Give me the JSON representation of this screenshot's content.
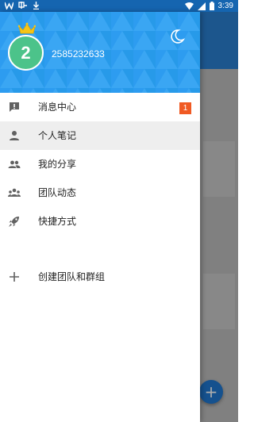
{
  "status_bar": {
    "time": "3:39"
  },
  "drawer": {
    "header": {
      "avatar_initial": "2",
      "user_id": "2585232633",
      "icons": [
        "crown-icon",
        "moon-icon"
      ]
    },
    "menu": {
      "items": [
        {
          "label": "消息中心",
          "icon": "message-icon",
          "badge": "1",
          "active": false
        },
        {
          "label": "个人笔记",
          "icon": "person-icon",
          "active": true
        },
        {
          "label": "我的分享",
          "icon": "share-people-icon",
          "active": false
        },
        {
          "label": "团队动态",
          "icon": "team-icon",
          "active": false
        },
        {
          "label": "快捷方式",
          "icon": "rocket-icon",
          "active": false
        }
      ],
      "create_item": {
        "label": "创建团队和群组",
        "icon": "plus-icon"
      }
    }
  },
  "colors": {
    "header_blue": "#2d9cf0",
    "avatar_green": "#4cc38a",
    "badge_orange": "#f05a23",
    "status_blue": "#1565b0"
  }
}
